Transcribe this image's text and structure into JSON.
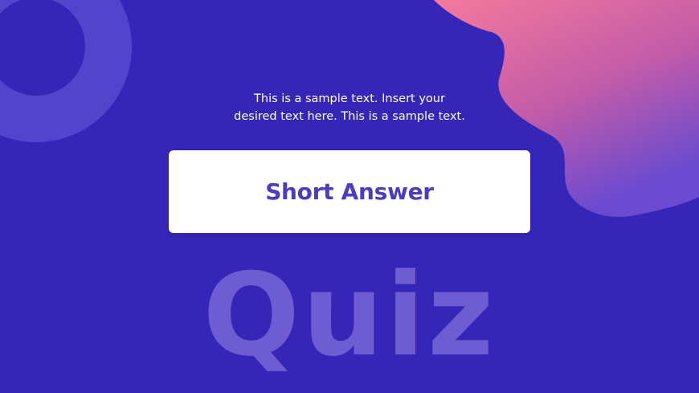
{
  "slide": {
    "subtitle_line1": "This is a sample text. Insert your",
    "subtitle_line2": "desired text here. This is a sample text.",
    "card_title": "Short Answer",
    "watermark": "Quiz"
  },
  "colors": {
    "background": "#3526b8",
    "ring": "#5443cc",
    "blob_top": "#f47a9c",
    "blob_bottom": "#6a4ad0",
    "card": "#ffffff",
    "card_title": "#4b3cc0",
    "watermark": "#6d5cd2"
  }
}
